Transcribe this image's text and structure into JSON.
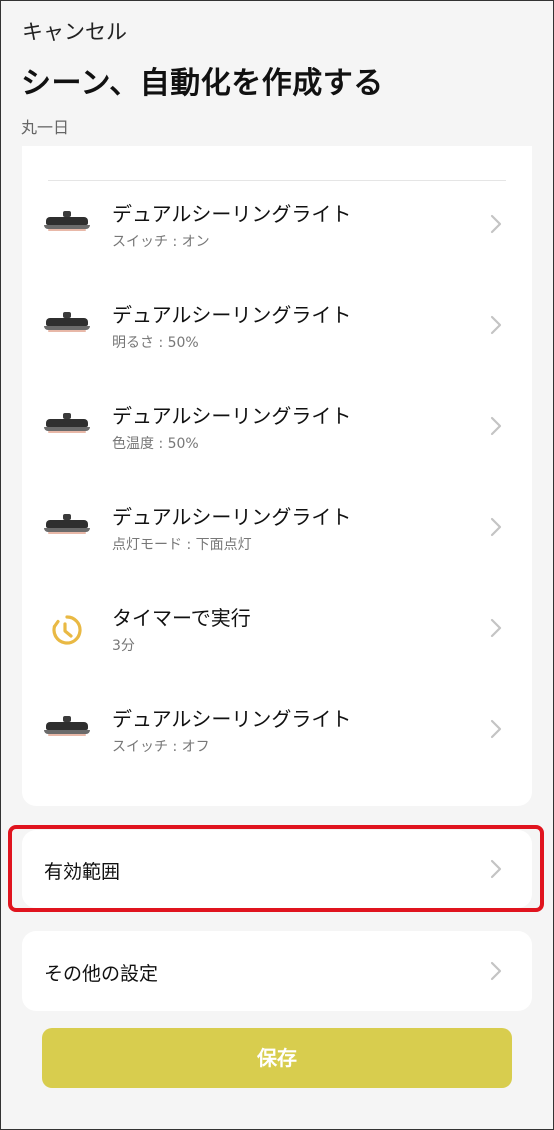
{
  "header": {
    "cancel_label": "キャンセル",
    "title": "シーン、自動化を作成する",
    "subtitle": "丸一日"
  },
  "actions": [
    {
      "name": "デュアルシーリングライト",
      "detail": "スイッチ : オン",
      "icon": "ceiling-light-icon"
    },
    {
      "name": "デュアルシーリングライト",
      "detail": "明るさ : 50%",
      "icon": "ceiling-light-icon"
    },
    {
      "name": "デュアルシーリングライト",
      "detail": "色温度 : 50%",
      "icon": "ceiling-light-icon"
    },
    {
      "name": "デュアルシーリングライト",
      "detail": "点灯モード : 下面点灯",
      "icon": "ceiling-light-icon"
    },
    {
      "name": "タイマーで実行",
      "detail": "3分",
      "icon": "timer-icon"
    },
    {
      "name": "デュアルシーリングライト",
      "detail": "スイッチ : オフ",
      "icon": "ceiling-light-icon"
    }
  ],
  "validity": {
    "label": "有効範囲"
  },
  "other_settings": {
    "label": "その他の設定"
  },
  "save_label": "保存",
  "colors": {
    "save_button": "#d8cd4e",
    "highlight_border": "#e0141e",
    "timer_icon": "#e9b944"
  }
}
